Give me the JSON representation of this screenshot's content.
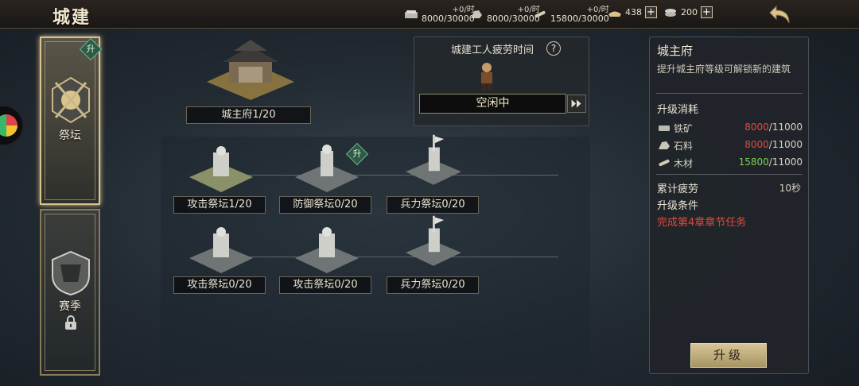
{
  "header": {
    "title": "城建",
    "resources": [
      {
        "icon": "iron-ore-icon",
        "rate": "+0/时",
        "amount": "8000/30000"
      },
      {
        "icon": "stone-icon",
        "rate": "+0/时",
        "amount": "8000/30000"
      },
      {
        "icon": "wood-icon",
        "rate": "+0/时",
        "amount": "15800/30000"
      }
    ],
    "wallet": [
      {
        "icon": "gold-ingot-icon",
        "value": "438"
      },
      {
        "icon": "silver-coin-icon",
        "value": "200"
      }
    ]
  },
  "tabs": [
    {
      "label": "祭坛",
      "badge": "升",
      "active": true
    },
    {
      "label": "赛季",
      "locked": true
    }
  ],
  "main": {
    "palace_name": "城主府1/20",
    "badge": "升",
    "buildings": [
      "攻击祭坛1/20",
      "防御祭坛0/20",
      "兵力祭坛0/20",
      "攻击祭坛0/20",
      "攻击祭坛0/20",
      "兵力祭坛0/20"
    ]
  },
  "worker": {
    "title": "城建工人疲劳时间",
    "help": "?",
    "status": "空闲中"
  },
  "info": {
    "title": "城主府",
    "desc": "提升城主府等级可解锁新的建筑",
    "cost_heading": "升级消耗",
    "costs": [
      {
        "name": "铁矿",
        "have": "8000",
        "need": "/11000",
        "sufficient": false
      },
      {
        "name": "石料",
        "have": "8000",
        "need": "/11000",
        "sufficient": false
      },
      {
        "name": "木材",
        "have": "15800",
        "need": "/11000",
        "sufficient": true
      }
    ],
    "fatigue_label": "累计疲劳",
    "fatigue_value": "10秒",
    "cond_heading": "升级条件",
    "cond_text": "完成第4章章节任务",
    "upgrade_label": "升级"
  },
  "colors": {
    "insufficient": "#e04a3a",
    "sufficient": "#7cd04a",
    "accent_gold": "#d9c58c"
  }
}
